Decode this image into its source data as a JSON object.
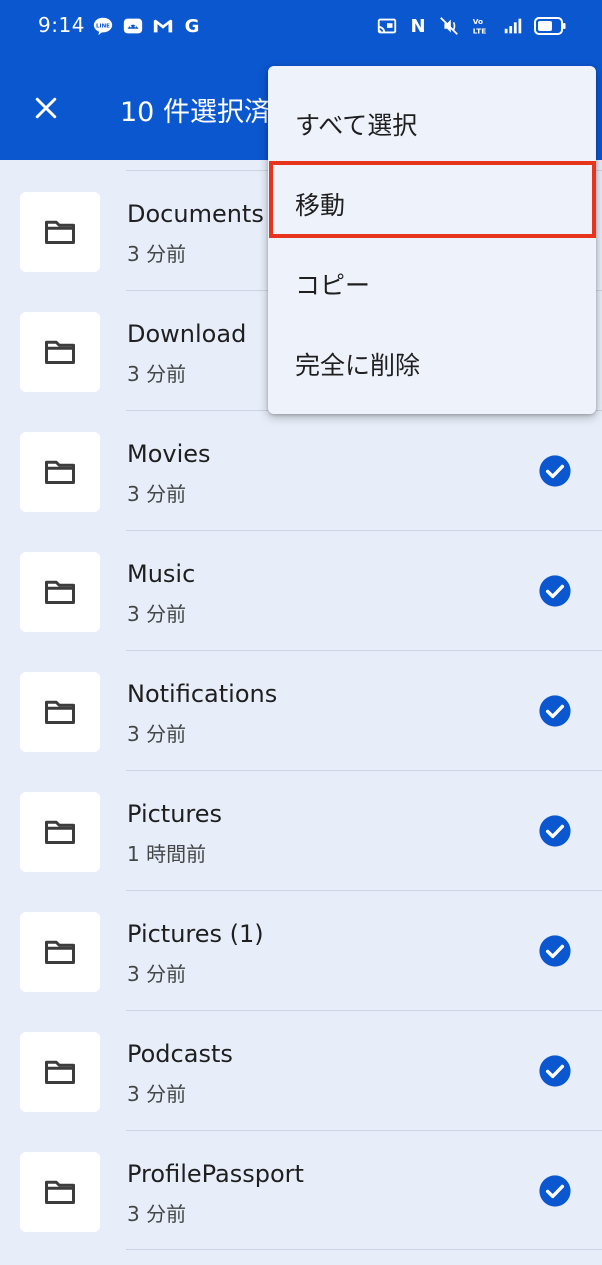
{
  "status_bar": {
    "time": "9:14",
    "left_icons": [
      "line-icon",
      "android-icon",
      "gmail-icon",
      "google-icon"
    ],
    "right_icons": [
      "cast-icon",
      "nfc-icon",
      "mute-icon",
      "volte-icon",
      "signal-icon",
      "battery-icon"
    ],
    "google_letter": "G",
    "nfc_letter": "N"
  },
  "app_bar": {
    "title": "10 件選択済",
    "color": "#0b57d0"
  },
  "files": [
    {
      "name": "Documents",
      "time": "3 分前",
      "checked": false
    },
    {
      "name": "Download",
      "time": "3 分前",
      "checked": false
    },
    {
      "name": "Movies",
      "time": "3 分前",
      "checked": true
    },
    {
      "name": "Music",
      "time": "3 分前",
      "checked": true
    },
    {
      "name": "Notifications",
      "time": "3 分前",
      "checked": true
    },
    {
      "name": "Pictures",
      "time": "1 時間前",
      "checked": true
    },
    {
      "name": "Pictures (1)",
      "time": "3 分前",
      "checked": true
    },
    {
      "name": "Podcasts",
      "time": "3 分前",
      "checked": true
    },
    {
      "name": "ProfilePassport",
      "time": "3 分前",
      "checked": true
    }
  ],
  "menu": {
    "items": [
      {
        "label": "すべて選択"
      },
      {
        "label": "移動"
      },
      {
        "label": "コピー"
      },
      {
        "label": "完全に削除"
      }
    ],
    "highlight_color": "#e8341c"
  }
}
